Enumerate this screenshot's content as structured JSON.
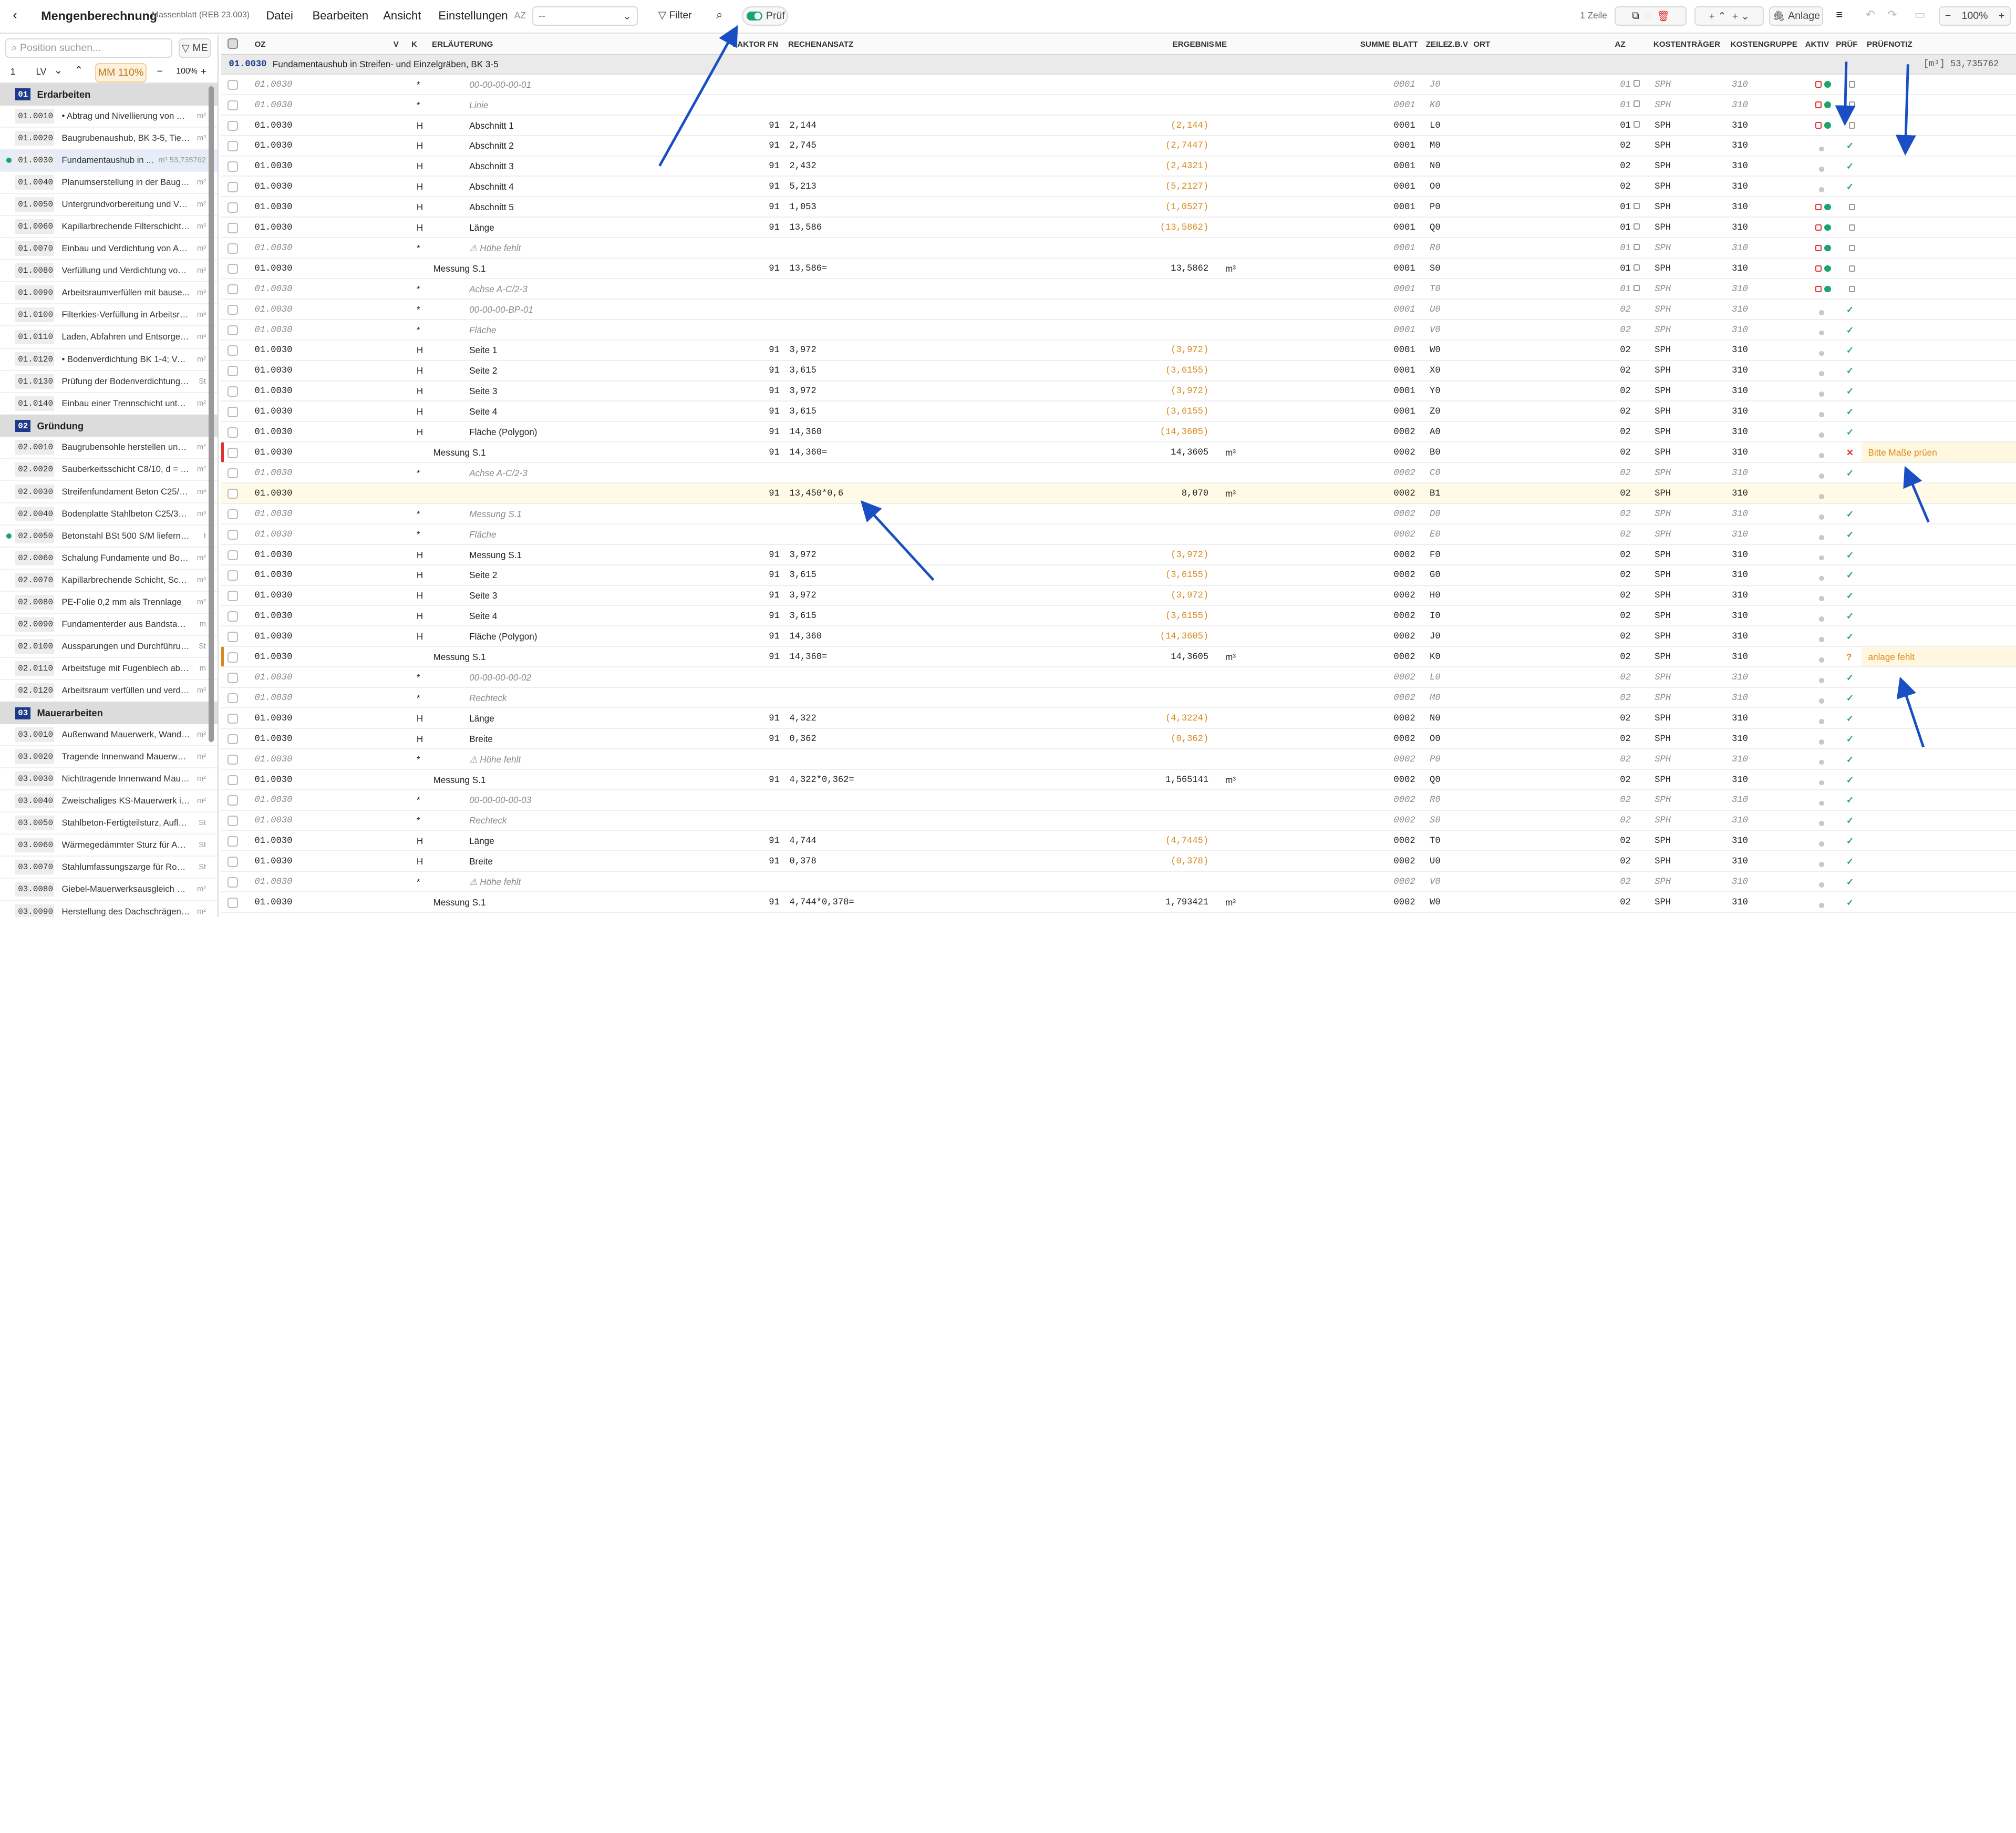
{
  "app": {
    "title": "Mengenberechnung",
    "subtitle": "Massenblatt (REB 23.003)"
  },
  "menu": [
    "Datei",
    "Bearbeiten",
    "Ansicht",
    "Einstellungen"
  ],
  "az_label": "AZ",
  "az_value": "--",
  "filter_label": "Filter",
  "pruef_label": "Prüf",
  "zeile_count": "1 Zeile",
  "anlage_label": "Anlage",
  "zoom_right": "100%",
  "sidebar": {
    "search_placeholder": "Position suchen...",
    "me_btn": "ME",
    "lv_num": "1",
    "lv_label": "LV",
    "mm_label": "MM 110%",
    "zoom": "100%",
    "groups": [
      {
        "num": "01",
        "label": "Erdarbeiten",
        "items": [
          {
            "oz": "01.0010",
            "text": "• Abtrag und Nivellierung von O...",
            "unit": "m²"
          },
          {
            "oz": "01.0020",
            "text": "Baugrubenaushub, BK 3-5, Tiefe ...",
            "unit": "m³"
          },
          {
            "oz": "01.0030",
            "text": "Fundamentaushub in ...",
            "unit": "m³ 53,735762",
            "sel": true,
            "dot": true
          },
          {
            "oz": "01.0040",
            "text": "Planumserstellung in der Baugru...",
            "unit": "m²"
          },
          {
            "oz": "01.0050",
            "text": "Untergrundvorbereitung und Ver...",
            "unit": "m²"
          },
          {
            "oz": "01.0060",
            "text": "Kapillarbrechende Filterschicht a...",
            "unit": "m³"
          },
          {
            "oz": "01.0070",
            "text": "Einbau und Verdichtung von Auf...",
            "unit": "m³"
          },
          {
            "oz": "01.0080",
            "text": "Verfüllung und Verdichtung von ...",
            "unit": "m³"
          },
          {
            "oz": "01.0090",
            "text": "Arbeitsraumverfüllen mit bause...",
            "unit": "m³"
          },
          {
            "oz": "01.0100",
            "text": "Filterkies-Verfüllung in Arbeitsrä...",
            "unit": "m³"
          },
          {
            "oz": "01.0110",
            "text": "Laden, Abfahren und Entsorgen ...",
            "unit": "m³"
          },
          {
            "oz": "01.0120",
            "text": "• Bodenverdichtung BK 1-4; Verk...",
            "unit": "m²"
          },
          {
            "oz": "01.0130",
            "text": "Prüfung der Bodenverdichtung m...",
            "unit": "St"
          },
          {
            "oz": "01.0140",
            "text": "Einbau einer Trennschicht unter ...",
            "unit": "m²"
          }
        ]
      },
      {
        "num": "02",
        "label": "Gründung",
        "items": [
          {
            "oz": "02.0010",
            "text": "Baugrubensohle herstellen und v...",
            "unit": "m²"
          },
          {
            "oz": "02.0020",
            "text": "Sauberkeitsschicht C8/10, d = 5 ...",
            "unit": "m²"
          },
          {
            "oz": "02.0030",
            "text": "Streifenfundament Beton C25/30...",
            "unit": "m³"
          },
          {
            "oz": "02.0040",
            "text": "Bodenplatte Stahlbeton C25/30, ...",
            "unit": "m³"
          },
          {
            "oz": "02.0050",
            "text": "Betonstahl BSt 500 S/M liefern un...",
            "unit": "t",
            "dot": true
          },
          {
            "oz": "02.0060",
            "text": "Schalung Fundamente und Bode...",
            "unit": "m²"
          },
          {
            "oz": "02.0070",
            "text": "Kapillarbrechende Schicht, Schot...",
            "unit": "m³"
          },
          {
            "oz": "02.0080",
            "text": "PE-Folie 0,2 mm als Trennlage",
            "unit": "m²"
          },
          {
            "oz": "02.0090",
            "text": "Fundamenterder aus Bandstahl 3...",
            "unit": "m"
          },
          {
            "oz": "02.0100",
            "text": "Aussparungen und Durchführung...",
            "unit": "St"
          },
          {
            "oz": "02.0110",
            "text": "Arbeitsfuge mit Fugenblech abdic...",
            "unit": "m"
          },
          {
            "oz": "02.0120",
            "text": "Arbeitsraum verfüllen und verdic...",
            "unit": "m³"
          }
        ]
      },
      {
        "num": "03",
        "label": "Mauerarbeiten",
        "items": [
          {
            "oz": "03.0010",
            "text": "Außenwand Mauerwerk, Wandst...",
            "unit": "m²"
          },
          {
            "oz": "03.0020",
            "text": "Tragende Innenwand Mauerwerk...",
            "unit": "m²"
          },
          {
            "oz": "03.0030",
            "text": "Nichttragende Innenwand Maue...",
            "unit": "m²"
          },
          {
            "oz": "03.0040",
            "text": "Zweischaliges KS-Mauerwerk im ...",
            "unit": "m²"
          },
          {
            "oz": "03.0050",
            "text": "Stahlbeton-Fertigteilsturz, Auflag...",
            "unit": "St"
          },
          {
            "oz": "03.0060",
            "text": "Wärmegedämmter Sturz für Auße...",
            "unit": "St"
          },
          {
            "oz": "03.0070",
            "text": "Stahlumfassungszarge für Rohba...",
            "unit": "St"
          },
          {
            "oz": "03.0080",
            "text": "Giebel-Mauerwerksausgleich mit ...",
            "unit": "m²"
          },
          {
            "oz": "03.0090",
            "text": "Herstellung des Dachschrägenan...",
            "unit": "m²"
          }
        ]
      }
    ]
  },
  "columns": [
    "OZ",
    "V",
    "K",
    "ERLÄUTERUNG",
    "FAKTOR",
    "FN",
    "RECHENANSATZ",
    "ERGEBNIS",
    "ME",
    "SUMME",
    "BLATT",
    "ZEILE",
    "Z.B.V",
    "ORT",
    "AZ",
    "KOSTENTRÄGER",
    "KOSTENGRUPPE",
    "AKTIV",
    "PRÜF",
    "PRÜFNOTIZ"
  ],
  "crumb": {
    "oz": "01.0030",
    "text": "Fundamentaushub in Streifen- und Einzelgräben, BK 3-5",
    "sum": "[m³] 53,735762"
  },
  "rows": [
    {
      "oz": "01.0030",
      "k": "*",
      "erl": "00-00-00-00-01",
      "blatt": "0001",
      "zeile": "J0",
      "az": "01",
      "kt": "SPH",
      "kg": "310",
      "it": true,
      "akt": "lock",
      "pr": "lock"
    },
    {
      "oz": "01.0030",
      "k": "*",
      "erl": "Linie",
      "blatt": "0001",
      "zeile": "K0",
      "az": "01",
      "kt": "SPH",
      "kg": "310",
      "it": true,
      "akt": "lock",
      "pr": "lock"
    },
    {
      "oz": "01.0030",
      "k": "H",
      "erl": "Abschnitt 1",
      "fn": "91",
      "re": "2,144",
      "erg": "(2,144)",
      "blatt": "0001",
      "zeile": "L0",
      "az": "01",
      "kt": "SPH",
      "kg": "310",
      "akt": "lock",
      "pr": "lock",
      "or": true
    },
    {
      "oz": "01.0030",
      "k": "H",
      "erl": "Abschnitt 2",
      "fn": "91",
      "re": "2,745",
      "erg": "(2,7447)",
      "blatt": "0001",
      "zeile": "M0",
      "az": "02",
      "kt": "SPH",
      "kg": "310",
      "akt": "grey",
      "pr": "check",
      "or": true
    },
    {
      "oz": "01.0030",
      "k": "H",
      "erl": "Abschnitt 3",
      "fn": "91",
      "re": "2,432",
      "erg": "(2,4321)",
      "blatt": "0001",
      "zeile": "N0",
      "az": "02",
      "kt": "SPH",
      "kg": "310",
      "akt": "grey",
      "pr": "check",
      "or": true
    },
    {
      "oz": "01.0030",
      "k": "H",
      "erl": "Abschnitt 4",
      "fn": "91",
      "re": "5,213",
      "erg": "(5,2127)",
      "blatt": "0001",
      "zeile": "O0",
      "az": "02",
      "kt": "SPH",
      "kg": "310",
      "akt": "grey",
      "pr": "check",
      "or": true
    },
    {
      "oz": "01.0030",
      "k": "H",
      "erl": "Abschnitt 5",
      "fn": "91",
      "re": "1,053",
      "erg": "(1,0527)",
      "blatt": "0001",
      "zeile": "P0",
      "az": "01",
      "kt": "SPH",
      "kg": "310",
      "akt": "lock",
      "pr": "lock",
      "or": true
    },
    {
      "oz": "01.0030",
      "k": "H",
      "erl": "Länge",
      "fn": "91",
      "re": "13,586",
      "erg": "(13,5862)",
      "blatt": "0001",
      "zeile": "Q0",
      "az": "01",
      "kt": "SPH",
      "kg": "310",
      "akt": "lock",
      "pr": "lock",
      "or": true
    },
    {
      "oz": "01.0030",
      "k": "*",
      "erl": "⚠ Höhe fehlt",
      "blatt": "0001",
      "zeile": "R0",
      "az": "01",
      "kt": "SPH",
      "kg": "310",
      "it": true,
      "akt": "lock",
      "pr": "lock"
    },
    {
      "oz": "01.0030",
      "k": "",
      "erl": "Messung S.1",
      "fn": "91",
      "re": "13,586=",
      "erg": "13,5862",
      "me": "m³",
      "blatt": "0001",
      "zeile": "S0",
      "az": "01",
      "kt": "SPH",
      "kg": "310",
      "akt": "lock",
      "pr": "lock"
    },
    {
      "oz": "01.0030",
      "k": "*",
      "erl": "Achse A-C/2-3",
      "blatt": "0001",
      "zeile": "T0",
      "az": "01",
      "kt": "SPH",
      "kg": "310",
      "it": true,
      "akt": "lock",
      "pr": "lock"
    },
    {
      "oz": "01.0030",
      "k": "*",
      "erl": "00-00-00-BP-01",
      "blatt": "0001",
      "zeile": "U0",
      "az": "02",
      "kt": "SPH",
      "kg": "310",
      "it": true,
      "akt": "grey",
      "pr": "check"
    },
    {
      "oz": "01.0030",
      "k": "*",
      "erl": "Fläche",
      "blatt": "0001",
      "zeile": "V0",
      "az": "02",
      "kt": "SPH",
      "kg": "310",
      "it": true,
      "akt": "grey",
      "pr": "check"
    },
    {
      "oz": "01.0030",
      "k": "H",
      "erl": "Seite 1",
      "fn": "91",
      "re": "3,972",
      "erg": "(3,972)",
      "blatt": "0001",
      "zeile": "W0",
      "az": "02",
      "kt": "SPH",
      "kg": "310",
      "akt": "grey",
      "pr": "check",
      "or": true
    },
    {
      "oz": "01.0030",
      "k": "H",
      "erl": "Seite 2",
      "fn": "91",
      "re": "3,615",
      "erg": "(3,6155)",
      "blatt": "0001",
      "zeile": "X0",
      "az": "02",
      "kt": "SPH",
      "kg": "310",
      "akt": "grey",
      "pr": "check",
      "or": true
    },
    {
      "oz": "01.0030",
      "k": "H",
      "erl": "Seite 3",
      "fn": "91",
      "re": "3,972",
      "erg": "(3,972)",
      "blatt": "0001",
      "zeile": "Y0",
      "az": "02",
      "kt": "SPH",
      "kg": "310",
      "akt": "grey",
      "pr": "check",
      "or": true
    },
    {
      "oz": "01.0030",
      "k": "H",
      "erl": "Seite 4",
      "fn": "91",
      "re": "3,615",
      "erg": "(3,6155)",
      "blatt": "0001",
      "zeile": "Z0",
      "az": "02",
      "kt": "SPH",
      "kg": "310",
      "akt": "grey",
      "pr": "check",
      "or": true
    },
    {
      "oz": "01.0030",
      "k": "H",
      "erl": "Fläche (Polygon)",
      "fn": "91",
      "re": "14,360",
      "erg": "(14,3605)",
      "blatt": "0002",
      "zeile": "A0",
      "az": "02",
      "kt": "SPH",
      "kg": "310",
      "akt": "grey",
      "pr": "check",
      "or": true
    },
    {
      "oz": "01.0030",
      "k": "",
      "erl": "Messung S.1",
      "fn": "91",
      "re": "14,360=",
      "erg": "14,3605",
      "me": "m³",
      "blatt": "0002",
      "zeile": "B0",
      "az": "02",
      "kt": "SPH",
      "kg": "310",
      "akt": "grey",
      "pr": "cross",
      "note": "Bitte Maße prüen",
      "mark": "red"
    },
    {
      "oz": "01.0030",
      "k": "*",
      "erl": "Achse A-C/2-3",
      "blatt": "0002",
      "zeile": "C0",
      "az": "02",
      "kt": "SPH",
      "kg": "310",
      "it": true,
      "akt": "grey",
      "pr": "check"
    },
    {
      "oz": "01.0030",
      "k": "",
      "erl": "",
      "fn": "91",
      "re": "13,450*0,6",
      "erg": "8,070",
      "me": "m³",
      "blatt": "0002",
      "zeile": "B1",
      "az": "02",
      "kt": "SPH",
      "kg": "310",
      "akt": "grey",
      "pr": "",
      "hl": true
    },
    {
      "oz": "01.0030",
      "k": "*",
      "erl": "Messung S.1",
      "blatt": "0002",
      "zeile": "D0",
      "az": "02",
      "kt": "SPH",
      "kg": "310",
      "it": true,
      "akt": "grey",
      "pr": "check"
    },
    {
      "oz": "01.0030",
      "k": "*",
      "erl": "Fläche",
      "blatt": "0002",
      "zeile": "E0",
      "az": "02",
      "kt": "SPH",
      "kg": "310",
      "it": true,
      "akt": "grey",
      "pr": "check"
    },
    {
      "oz": "01.0030",
      "k": "H",
      "erl": "Messung S.1",
      "fn": "91",
      "re": "3,972",
      "erg": "(3,972)",
      "blatt": "0002",
      "zeile": "F0",
      "az": "02",
      "kt": "SPH",
      "kg": "310",
      "akt": "grey",
      "pr": "check",
      "or": true
    },
    {
      "oz": "01.0030",
      "k": "H",
      "erl": "Seite 2",
      "fn": "91",
      "re": "3,615",
      "erg": "(3,6155)",
      "blatt": "0002",
      "zeile": "G0",
      "az": "02",
      "kt": "SPH",
      "kg": "310",
      "akt": "grey",
      "pr": "check",
      "or": true
    },
    {
      "oz": "01.0030",
      "k": "H",
      "erl": "Seite 3",
      "fn": "91",
      "re": "3,972",
      "erg": "(3,972)",
      "blatt": "0002",
      "zeile": "H0",
      "az": "02",
      "kt": "SPH",
      "kg": "310",
      "akt": "grey",
      "pr": "check",
      "or": true
    },
    {
      "oz": "01.0030",
      "k": "H",
      "erl": "Seite 4",
      "fn": "91",
      "re": "3,615",
      "erg": "(3,6155)",
      "blatt": "0002",
      "zeile": "I0",
      "az": "02",
      "kt": "SPH",
      "kg": "310",
      "akt": "grey",
      "pr": "check",
      "or": true
    },
    {
      "oz": "01.0030",
      "k": "H",
      "erl": "Fläche (Polygon)",
      "fn": "91",
      "re": "14,360",
      "erg": "(14,3605)",
      "blatt": "0002",
      "zeile": "J0",
      "az": "02",
      "kt": "SPH",
      "kg": "310",
      "akt": "grey",
      "pr": "check",
      "or": true
    },
    {
      "oz": "01.0030",
      "k": "",
      "erl": "Messung S.1",
      "fn": "91",
      "re": "14,360=",
      "erg": "14,3605",
      "me": "m³",
      "blatt": "0002",
      "zeile": "K0",
      "az": "02",
      "kt": "SPH",
      "kg": "310",
      "akt": "grey",
      "pr": "q",
      "note": "anlage fehlt",
      "mark": "orange"
    },
    {
      "oz": "01.0030",
      "k": "*",
      "erl": "00-00-00-00-02",
      "blatt": "0002",
      "zeile": "L0",
      "az": "02",
      "kt": "SPH",
      "kg": "310",
      "it": true,
      "akt": "grey",
      "pr": "check"
    },
    {
      "oz": "01.0030",
      "k": "*",
      "erl": "Rechteck",
      "blatt": "0002",
      "zeile": "M0",
      "az": "02",
      "kt": "SPH",
      "kg": "310",
      "it": true,
      "akt": "grey",
      "pr": "check"
    },
    {
      "oz": "01.0030",
      "k": "H",
      "erl": "Länge",
      "fn": "91",
      "re": "4,322",
      "erg": "(4,3224)",
      "blatt": "0002",
      "zeile": "N0",
      "az": "02",
      "kt": "SPH",
      "kg": "310",
      "akt": "grey",
      "pr": "check",
      "or": true
    },
    {
      "oz": "01.0030",
      "k": "H",
      "erl": "Breite",
      "fn": "91",
      "re": "0,362",
      "erg": "(0,362)",
      "blatt": "0002",
      "zeile": "O0",
      "az": "02",
      "kt": "SPH",
      "kg": "310",
      "akt": "grey",
      "pr": "check",
      "or": true
    },
    {
      "oz": "01.0030",
      "k": "*",
      "erl": "⚠ Höhe fehlt",
      "blatt": "0002",
      "zeile": "P0",
      "az": "02",
      "kt": "SPH",
      "kg": "310",
      "it": true,
      "akt": "grey",
      "pr": "check"
    },
    {
      "oz": "01.0030",
      "k": "",
      "erl": "Messung S.1",
      "fn": "91",
      "re": "4,322*0,362=",
      "erg": "1,565141",
      "me": "m³",
      "blatt": "0002",
      "zeile": "Q0",
      "az": "02",
      "kt": "SPH",
      "kg": "310",
      "akt": "grey",
      "pr": "check"
    },
    {
      "oz": "01.0030",
      "k": "*",
      "erl": "00-00-00-00-03",
      "blatt": "0002",
      "zeile": "R0",
      "az": "02",
      "kt": "SPH",
      "kg": "310",
      "it": true,
      "akt": "grey",
      "pr": "check"
    },
    {
      "oz": "01.0030",
      "k": "*",
      "erl": "Rechteck",
      "blatt": "0002",
      "zeile": "S0",
      "az": "02",
      "kt": "SPH",
      "kg": "310",
      "it": true,
      "akt": "grey",
      "pr": "check"
    },
    {
      "oz": "01.0030",
      "k": "H",
      "erl": "Länge",
      "fn": "91",
      "re": "4,744",
      "erg": "(4,7445)",
      "blatt": "0002",
      "zeile": "T0",
      "az": "02",
      "kt": "SPH",
      "kg": "310",
      "akt": "grey",
      "pr": "check",
      "or": true
    },
    {
      "oz": "01.0030",
      "k": "H",
      "erl": "Breite",
      "fn": "91",
      "re": "0,378",
      "erg": "(0,378)",
      "blatt": "0002",
      "zeile": "U0",
      "az": "02",
      "kt": "SPH",
      "kg": "310",
      "akt": "grey",
      "pr": "check",
      "or": true
    },
    {
      "oz": "01.0030",
      "k": "*",
      "erl": "⚠ Höhe fehlt",
      "blatt": "0002",
      "zeile": "V0",
      "az": "02",
      "kt": "SPH",
      "kg": "310",
      "it": true,
      "akt": "grey",
      "pr": "check"
    },
    {
      "oz": "01.0030",
      "k": "",
      "erl": "Messung S.1",
      "fn": "91",
      "re": "4,744*0,378=",
      "erg": "1,793421",
      "me": "m³",
      "blatt": "0002",
      "zeile": "W0",
      "az": "02",
      "kt": "SPH",
      "kg": "310",
      "akt": "grey",
      "pr": "check"
    }
  ],
  "colors": {
    "accent": "#1d3a8a",
    "ok": "#1aa56b",
    "warn": "#d98a1c",
    "err": "#dd3333",
    "arrow": "#1a4fc4"
  }
}
